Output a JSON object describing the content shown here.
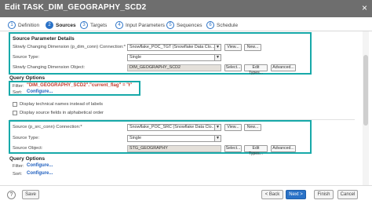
{
  "window": {
    "title": "Edit TASK_DIM_GEOGRAPHY_SCD2",
    "close_glyph": "×"
  },
  "steps": [
    {
      "num": "1",
      "label": "Definition"
    },
    {
      "num": "2",
      "label": "Sources"
    },
    {
      "num": "3",
      "label": "Targets"
    },
    {
      "num": "4",
      "label": "Input Parameters"
    },
    {
      "num": "5",
      "label": "Sequences"
    },
    {
      "num": "6",
      "label": "Schedule"
    }
  ],
  "active_step": "Sources",
  "source_params": {
    "heading": "Source Parameter Details",
    "connection_label": "Slowly Changing Dimension (p_dim_conn) Connection:*",
    "connection_value": "Snowflake_POC_TGT (Snowflake Data Clo...",
    "view_label": "View...",
    "new_label": "New...",
    "type_label": "Source Type:",
    "type_value": "Single",
    "object_label": "Slowly Changing Dimension Object:",
    "object_value": "DIM_GEOGRAPHY_SCD2",
    "select_label": "Select...",
    "edit_types_label": "Edit Types...",
    "advanced_label": "Advanced..."
  },
  "query_options_1": {
    "heading": "Query Options",
    "filter_label": "Filter:",
    "filter_value": "\"DIM_GEOGRAPHY_SCD2\".\"current_flag\" = 'Y'",
    "sort_label": "Sort:",
    "sort_value": "Configure..."
  },
  "checkboxes": [
    "Display technical names instead of labels",
    "Display source fields in alphabetical order"
  ],
  "src_params": {
    "connection_label": "Source (p_src_conn) Connection:*",
    "connection_value": "Snowflake_POC_SRC (Snowflake Data Clo...",
    "view_label": "View...",
    "new_label": "New...",
    "type_label": "Source Type:",
    "type_value": "Single",
    "object_label": "Source Object:",
    "object_value": "STG_GEOGRAPHY",
    "select_label": "Select...",
    "edit_types_label": "Edit Types...",
    "advanced_label": "Advanced..."
  },
  "query_options_2": {
    "heading": "Query Options",
    "filter_label": "Filter:",
    "filter_value": "Configure...",
    "sort_label": "Sort:",
    "sort_value": "Configure..."
  },
  "footer": {
    "help_glyph": "?",
    "save_label": "Save",
    "back_label": "< Back",
    "next_label": "Next >",
    "finish_label": "Finish",
    "cancel_label": "Cancel"
  },
  "colors": {
    "titlebar": "#6e6e6e",
    "accent": "#2a72c7",
    "highlight": "#17a9a9",
    "filter_text": "#c0392b"
  }
}
